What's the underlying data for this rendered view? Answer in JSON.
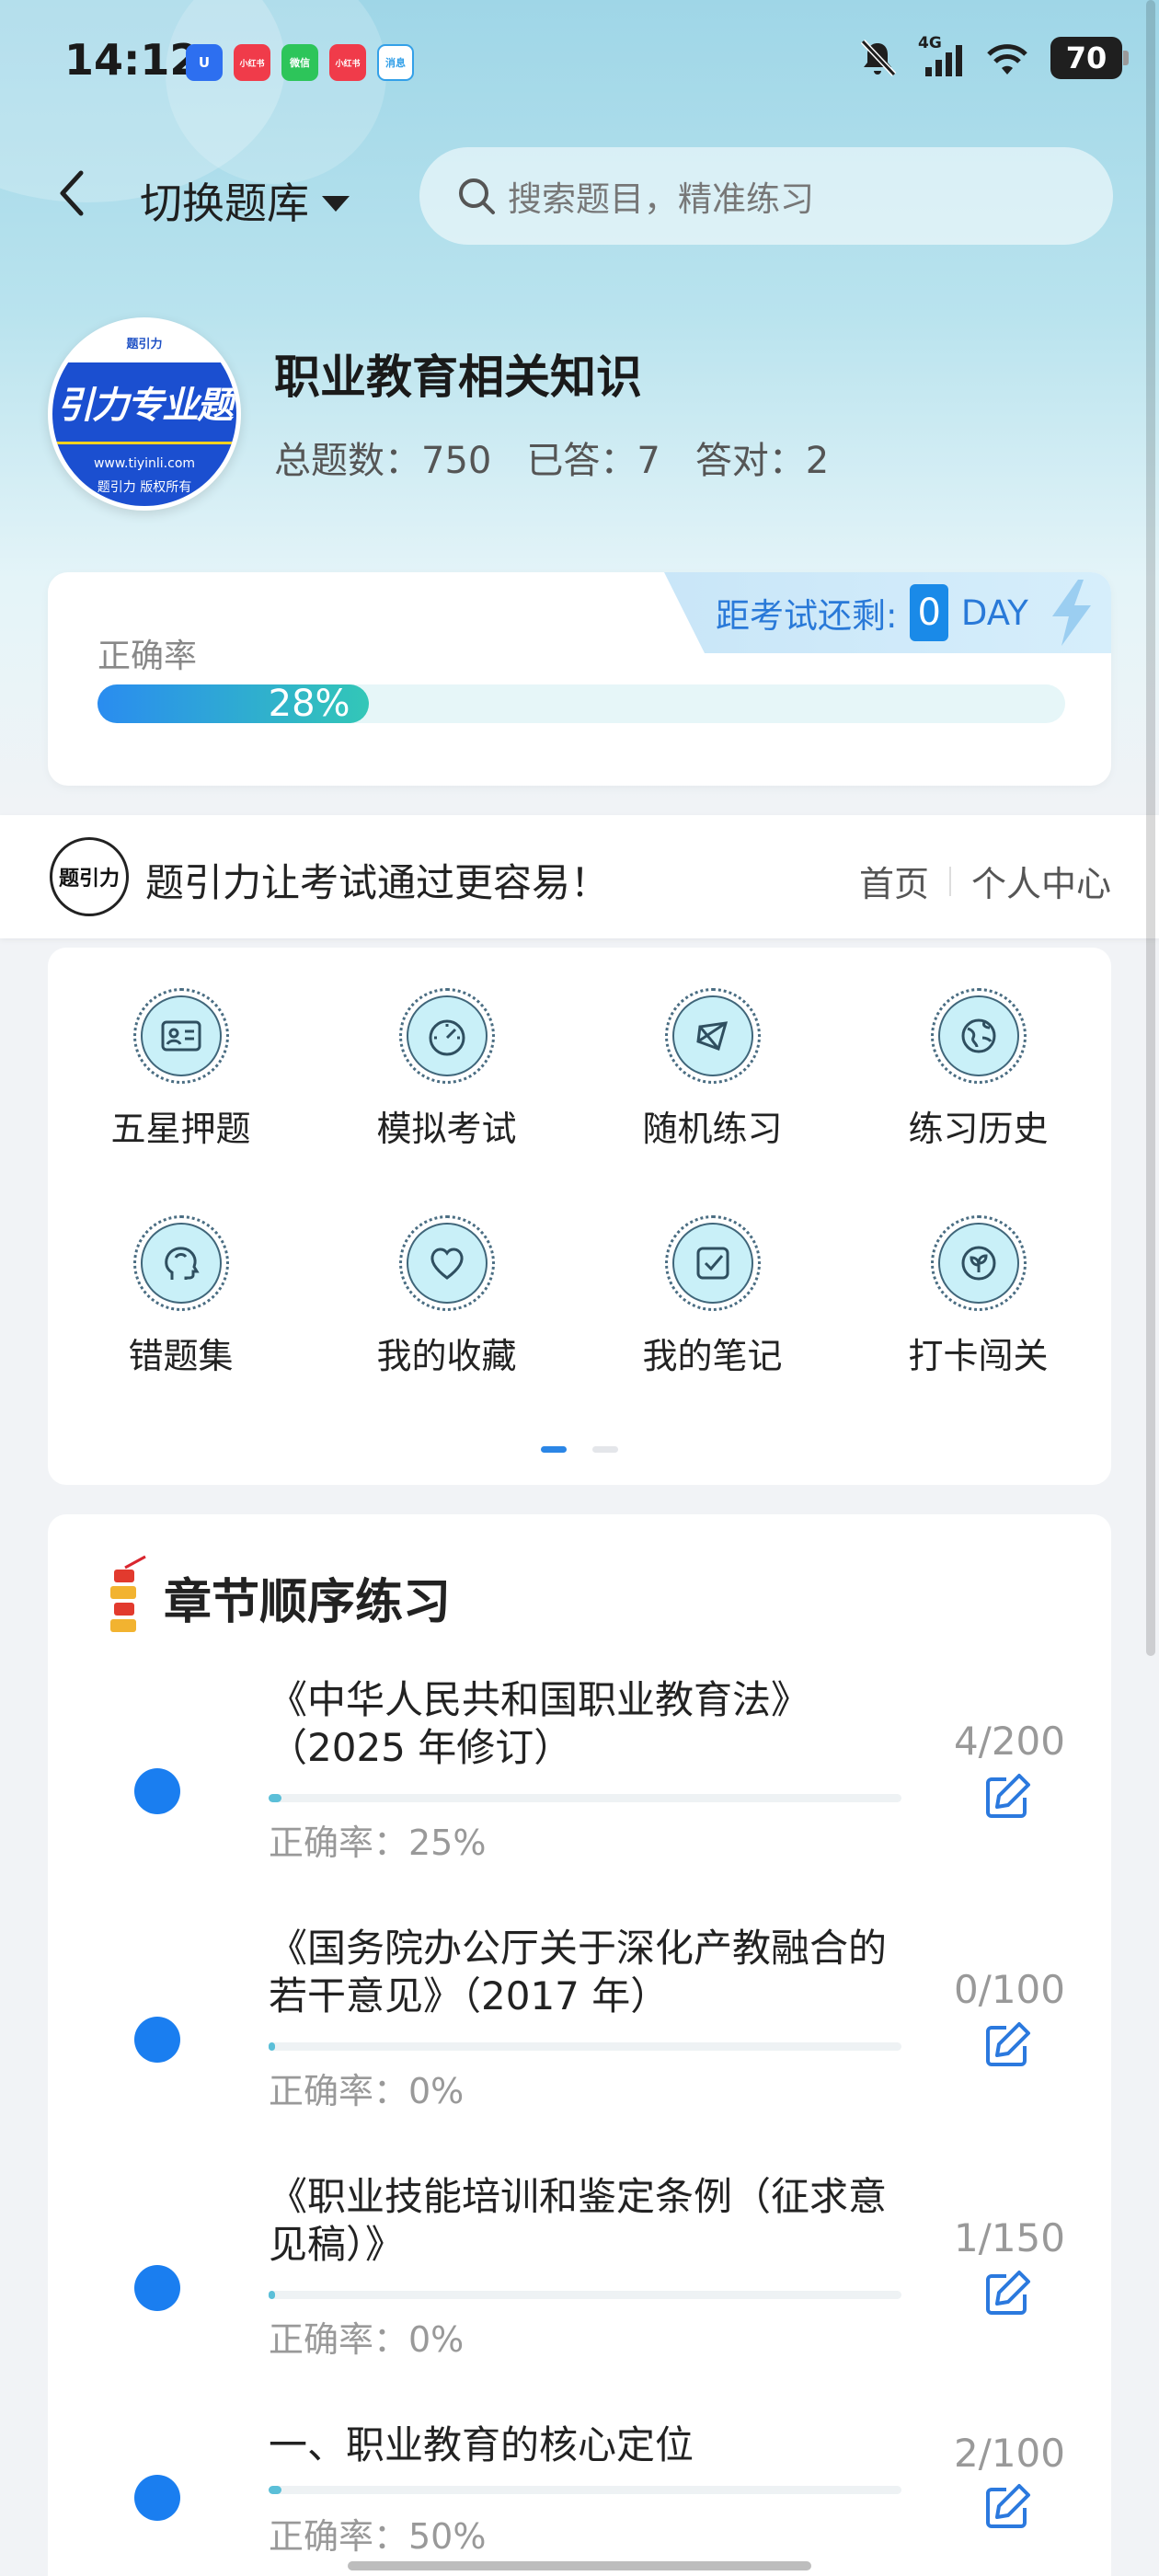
{
  "status": {
    "time": "14:12",
    "apps": [
      "U",
      "小红书",
      "微信",
      "小红书",
      "消息"
    ],
    "battery": "70",
    "network": "4G"
  },
  "nav": {
    "switch_label": "切换题库",
    "search_placeholder": "搜索题目，精准练习"
  },
  "course": {
    "logo_top": "题引力",
    "logo_main": "引力专业题",
    "logo_url": "www.tiyinli.com",
    "logo_owner": "题引力 版权所有",
    "title": "职业教育相关知识",
    "total": "总题数：750",
    "answered": "已答：7",
    "correct": "答对：2"
  },
  "accuracy": {
    "label": "正确率",
    "value_text": "28%",
    "value": 0.28,
    "exam_label": "距考试还剩:",
    "exam_days": "0",
    "exam_unit": "DAY"
  },
  "promo": {
    "logo_text": "题引力",
    "text": "题引力让考试通过更容易！",
    "link_home": "首页",
    "link_profile": "个人中心"
  },
  "grid": {
    "items": [
      {
        "label": "五星押题",
        "icon": "id-card-icon"
      },
      {
        "label": "模拟考试",
        "icon": "gauge-icon"
      },
      {
        "label": "随机练习",
        "icon": "random-icon"
      },
      {
        "label": "练习历史",
        "icon": "globe-icon"
      },
      {
        "label": "错题集",
        "icon": "head-icon"
      },
      {
        "label": "我的收藏",
        "icon": "heart-icon"
      },
      {
        "label": "我的笔记",
        "icon": "note-check-icon"
      },
      {
        "label": "打卡闯关",
        "icon": "leaf-badge-icon"
      }
    ]
  },
  "chapters": {
    "title": "章节顺序练习",
    "items": [
      {
        "name": "《中华人民共和国职业教育法》（2025 年修订）",
        "acc": "正确率：25%",
        "count": "4/200",
        "progress": 0.02
      },
      {
        "name": "《国务院办公厅关于深化产教融合的若干意见》（2017 年）",
        "acc": "正确率：0%",
        "count": "0/100",
        "progress": 0.0
      },
      {
        "name": "《职业技能培训和鉴定条例（征求意见稿）》",
        "acc": "正确率：0%",
        "count": "1/150",
        "progress": 0.007
      },
      {
        "name": "一、职业教育的核心定位",
        "acc": "正确率：50%",
        "count": "2/100",
        "progress": 0.02
      }
    ]
  },
  "colors": {
    "accent": "#1a7ef0",
    "teal": "#33c7b7"
  }
}
